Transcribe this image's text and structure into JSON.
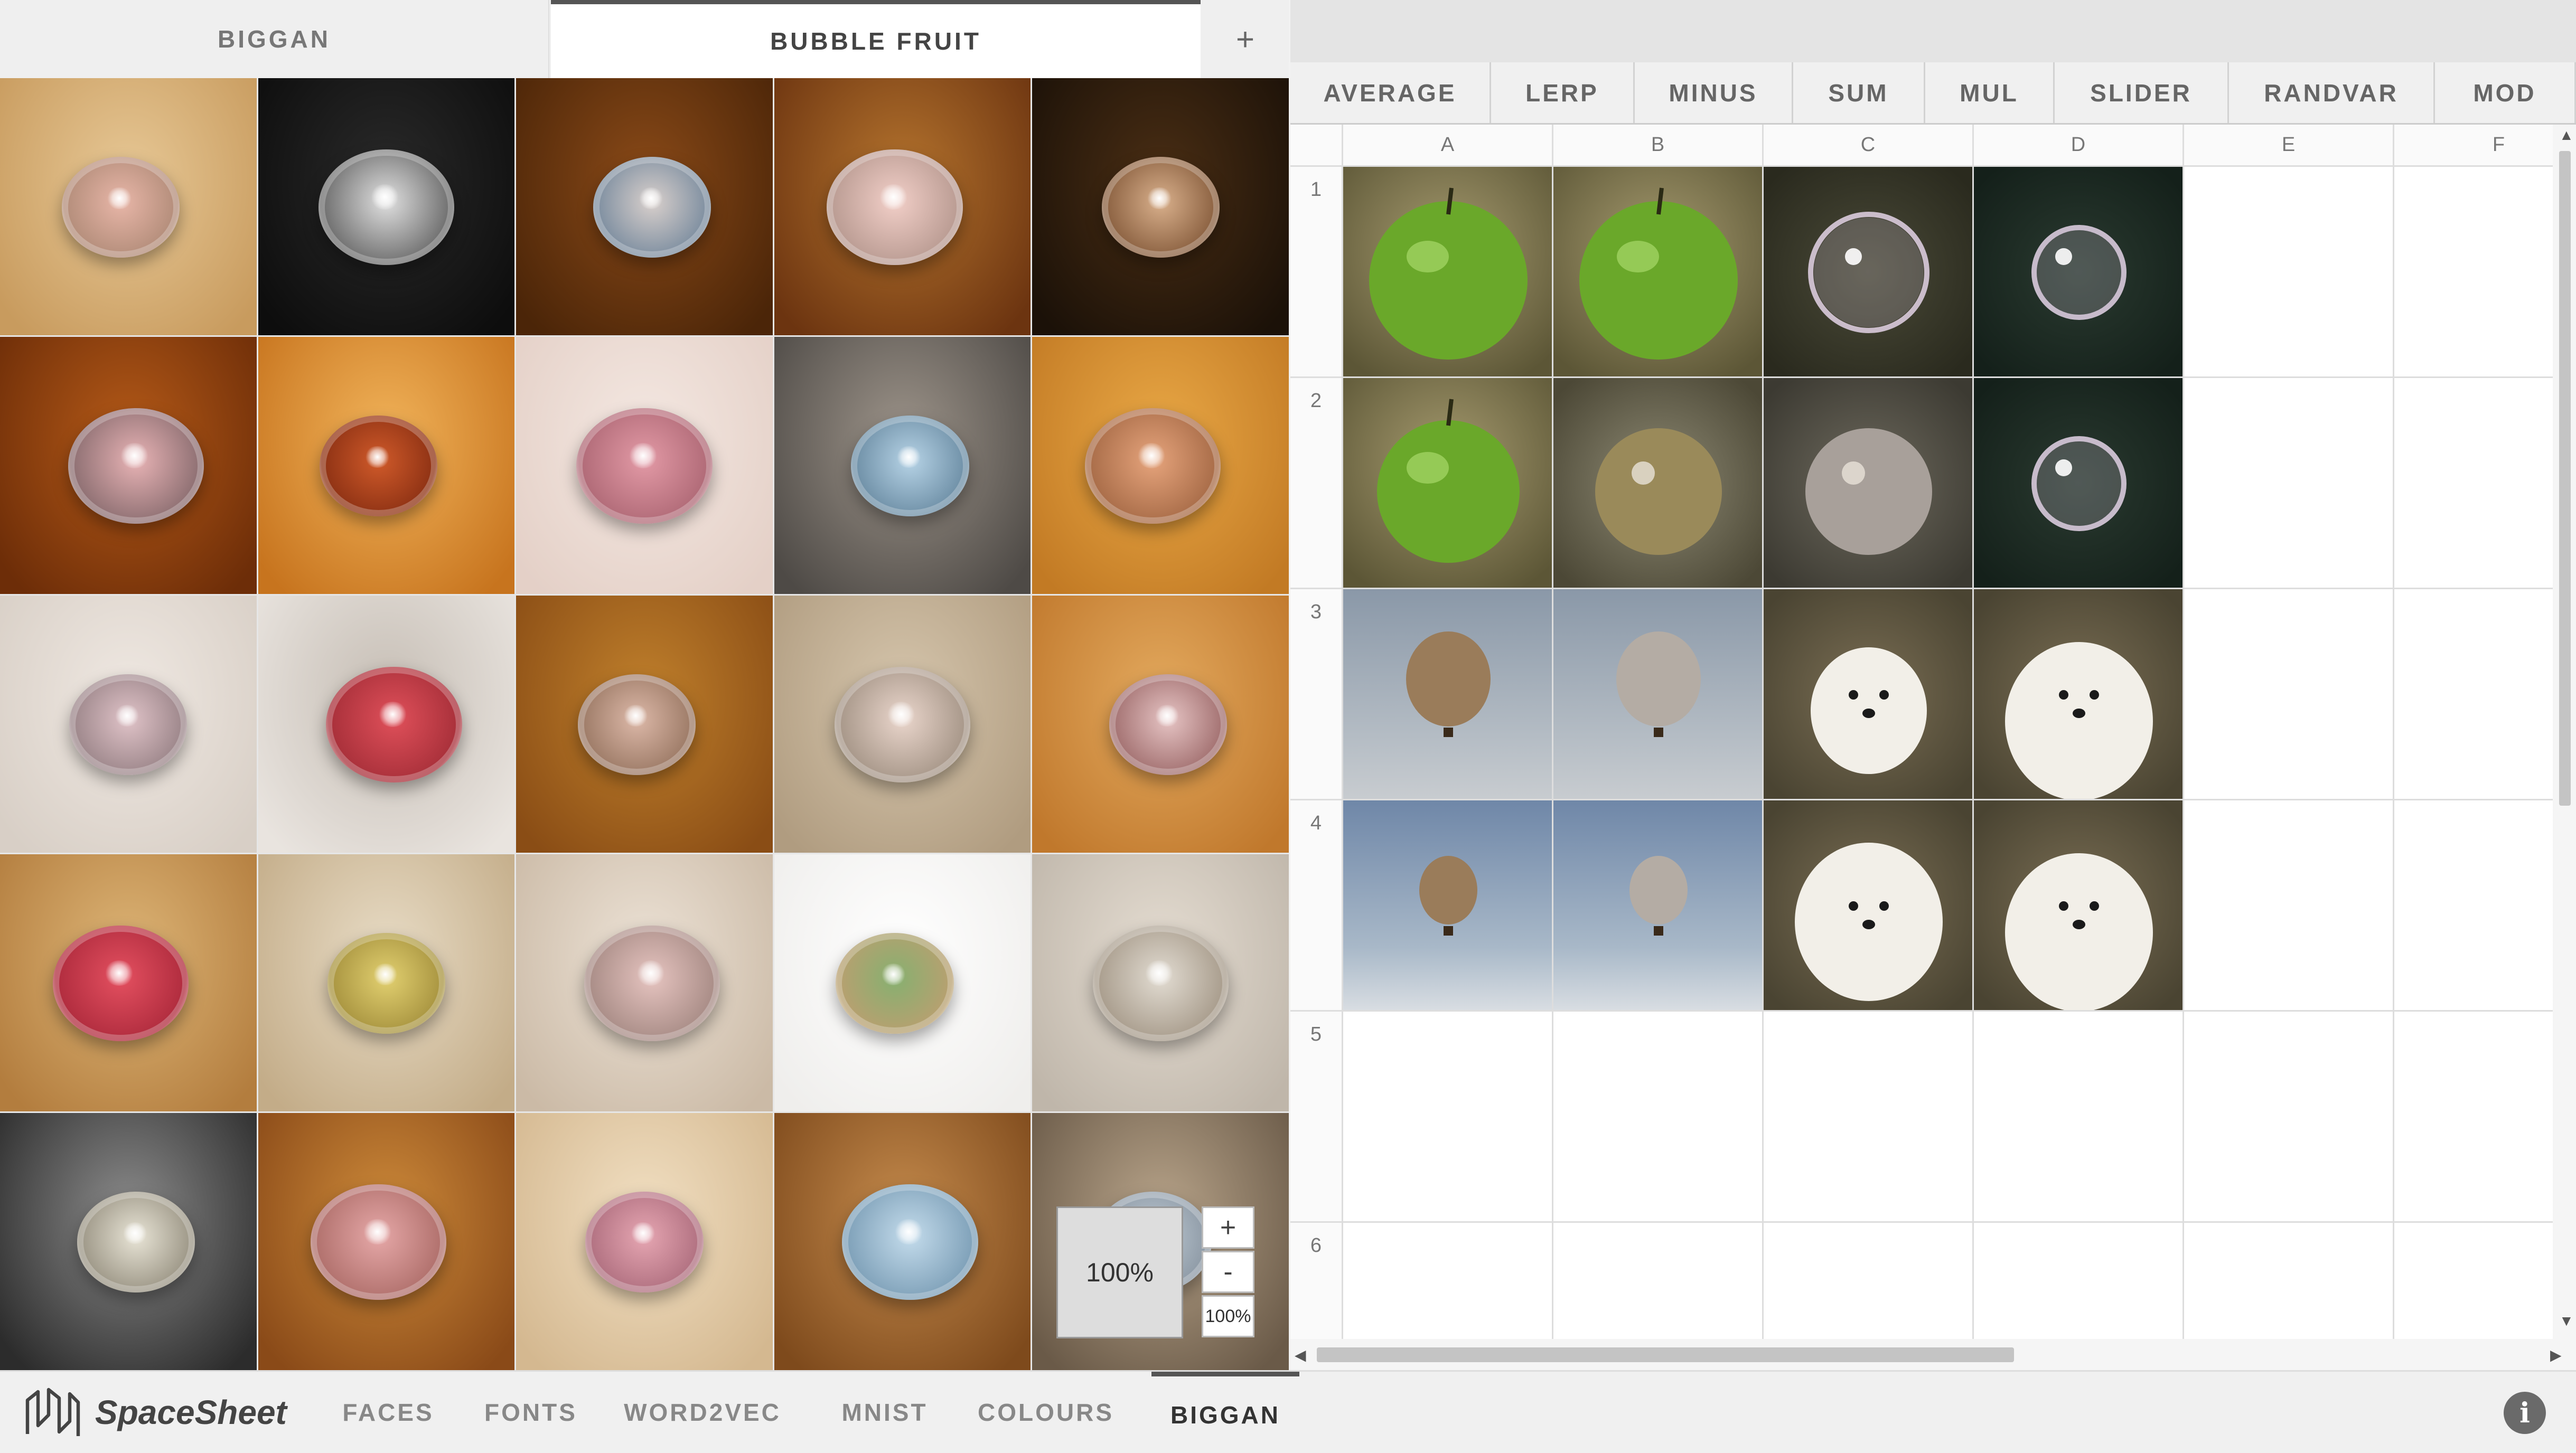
{
  "left_tabs": [
    {
      "label": "BIGGAN",
      "active": false
    },
    {
      "label": "BUBBLE FRUIT",
      "active": true
    }
  ],
  "add_tab_label": "+",
  "zoom": {
    "display": "100%",
    "plus": "+",
    "minus": "-",
    "percent": "100%"
  },
  "operations": [
    "AVERAGE",
    "LERP",
    "MINUS",
    "SUM",
    "MUL",
    "SLIDER",
    "RANDVAR",
    "MOD"
  ],
  "columns": [
    "A",
    "B",
    "C",
    "D",
    "E",
    "F"
  ],
  "rows": [
    "1",
    "2",
    "3",
    "4",
    "5",
    "6"
  ],
  "cell_images": [
    [
      "green-apple",
      "green-apple",
      "soap-bubble",
      "soap-bubble",
      "",
      ""
    ],
    [
      "green-apple",
      "apple-bubble-blend",
      "apple-bubble-blend",
      "soap-bubble",
      "",
      ""
    ],
    [
      "hot-air-balloon",
      "hot-air-balloon",
      "white-puppy",
      "white-puppy",
      "",
      ""
    ],
    [
      "hot-air-balloon",
      "hot-air-balloon",
      "white-puppy",
      "white-puppy",
      "",
      ""
    ],
    [
      "",
      "",
      "",
      "",
      "",
      ""
    ],
    [
      "",
      "",
      "",
      "",
      "",
      ""
    ]
  ],
  "app_name": "SpaceSheet",
  "nav_items": [
    {
      "label": "FACES",
      "active": false
    },
    {
      "label": "FONTS",
      "active": false
    },
    {
      "label": "WORD2VEC",
      "active": false
    },
    {
      "label": "MNIST",
      "active": false
    },
    {
      "label": "COLOURS",
      "active": false
    },
    {
      "label": "BIGGAN",
      "active": true
    }
  ],
  "info_label": "i",
  "colors": {
    "accent": "#555555",
    "panel": "#f0f0f0",
    "grid": "#dddddd"
  }
}
